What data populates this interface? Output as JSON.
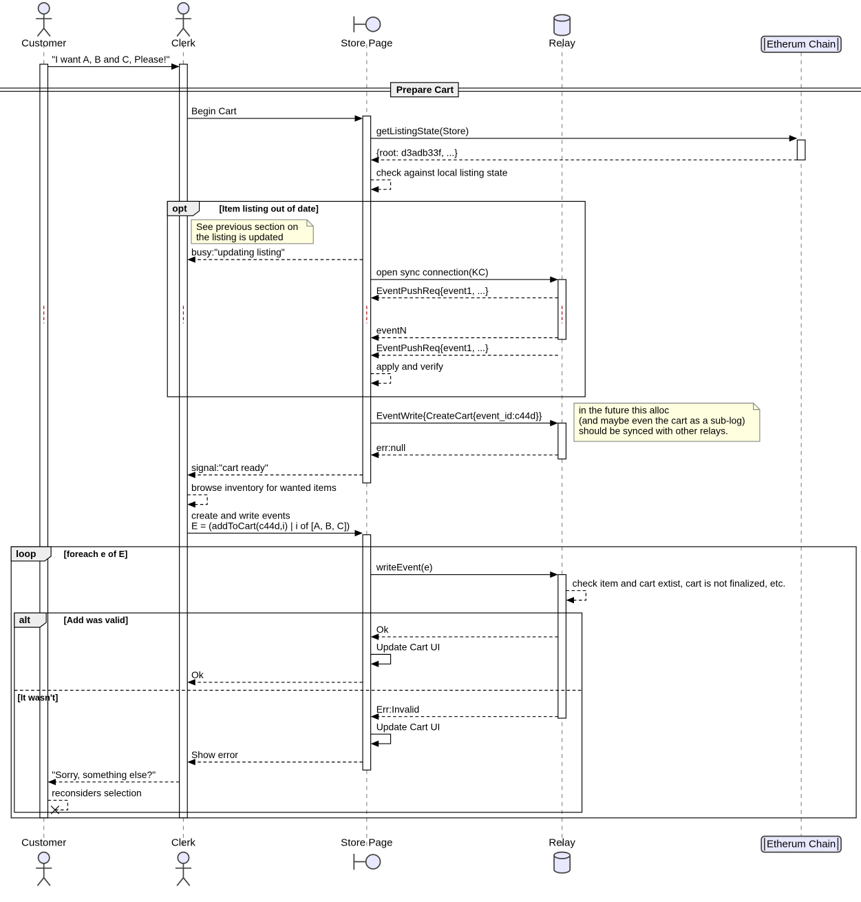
{
  "participants": {
    "customer": "Customer",
    "clerk": "Clerk",
    "storepage": "Store Page",
    "relay": "Relay",
    "chain": "Etherum Chain"
  },
  "divider": "Prepare Cart",
  "messages": {
    "m1": "\"I want A, B and C, Please!\"",
    "m2": "Begin Cart",
    "m3": "getListingState(Store)",
    "m4": "{root: d3adb33f, ...}",
    "m5": "check against local listing state",
    "m6": "busy:\"updating listing\"",
    "m7": "open sync connection(KC)",
    "m8": "EventPushReq{event1, ...}",
    "m9": "eventN",
    "m10": "EventPushReq{event1, ...}",
    "m11": "apply and verify",
    "m12": "EventWrite{CreateCart{event_id:c44d}}",
    "m13": "err:null",
    "m14": "signal:\"cart ready\"",
    "m15": "browse inventory for wanted items",
    "m16a": "create and write events",
    "m16b": "E = (addToCart(c44d,i) | i of [A, B, C])",
    "m17": "writeEvent(e)",
    "m18": "check item and cart extist, cart is not finalized, etc.",
    "m19": "Ok",
    "m20": "Update Cart UI",
    "m21": "Ok",
    "m22": "Err:Invalid",
    "m23": "Update Cart UI",
    "m24": "Show error",
    "m25": "\"Sorry, something else?\"",
    "m26": "reconsiders selection"
  },
  "blocks": {
    "opt": "opt",
    "opt_guard": "[Item listing out of date]",
    "loop": "loop",
    "loop_guard": "[foreach e of E]",
    "alt": "alt",
    "alt_guard1": "[Add was valid]",
    "alt_guard2": "[It wasn't]"
  },
  "notes": {
    "note1a": "See previous section on",
    "note1b": "the listing is updated",
    "note2a": "in the future this alloc",
    "note2b": "(and maybe even the cart as a sub-log)",
    "note2c": "should be synced with other relays."
  }
}
